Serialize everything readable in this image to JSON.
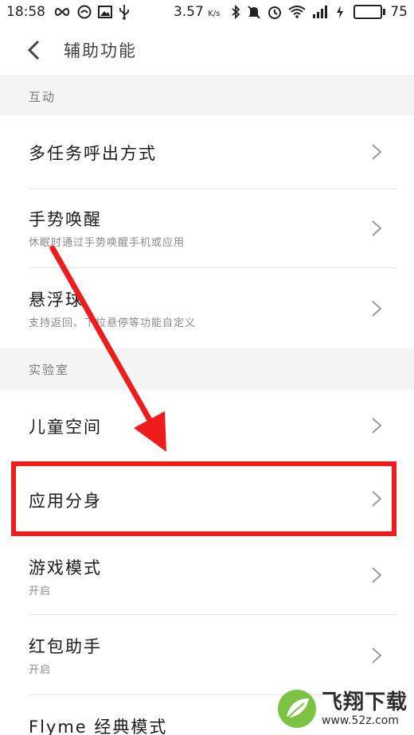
{
  "status_bar": {
    "time": "18:58",
    "speed_value": "3.57",
    "speed_unit": "K/s",
    "battery_percent": "75",
    "battery_level": 0.75,
    "icons": [
      "infinity-icon",
      "circle-status-icon",
      "image-icon",
      "usb-icon",
      "bluetooth-icon",
      "mute-icon",
      "alarm-icon",
      "wifi-icon",
      "signal-icon",
      "charging-icon",
      "battery-icon"
    ]
  },
  "header": {
    "title": "辅助功能",
    "back_icon": "chevron-left-icon"
  },
  "sections": {
    "interaction": {
      "title": "互动",
      "items": [
        {
          "label": "多任务呼出方式",
          "sub": ""
        },
        {
          "label": "手势唤醒",
          "sub": "休眠时通过手势唤醒手机或应用"
        },
        {
          "label": "悬浮球",
          "sub": "支持返回、下拉悬停等功能自定义"
        }
      ]
    },
    "lab": {
      "title": "实验室",
      "items": [
        {
          "label": "儿童空间",
          "sub": ""
        },
        {
          "label": "应用分身",
          "sub": ""
        },
        {
          "label": "游戏模式",
          "sub": "开启"
        },
        {
          "label": "红包助手",
          "sub": "开启"
        },
        {
          "label": "Flyme 经典模式",
          "sub": ""
        }
      ]
    }
  },
  "annotation": {
    "highlight_color": "#ee1c1c",
    "arrow_color": "#ee1c1c"
  },
  "watermark": {
    "brand": "飞翔下载",
    "url": "www.52z.com",
    "logo_color": "#7cc243"
  }
}
